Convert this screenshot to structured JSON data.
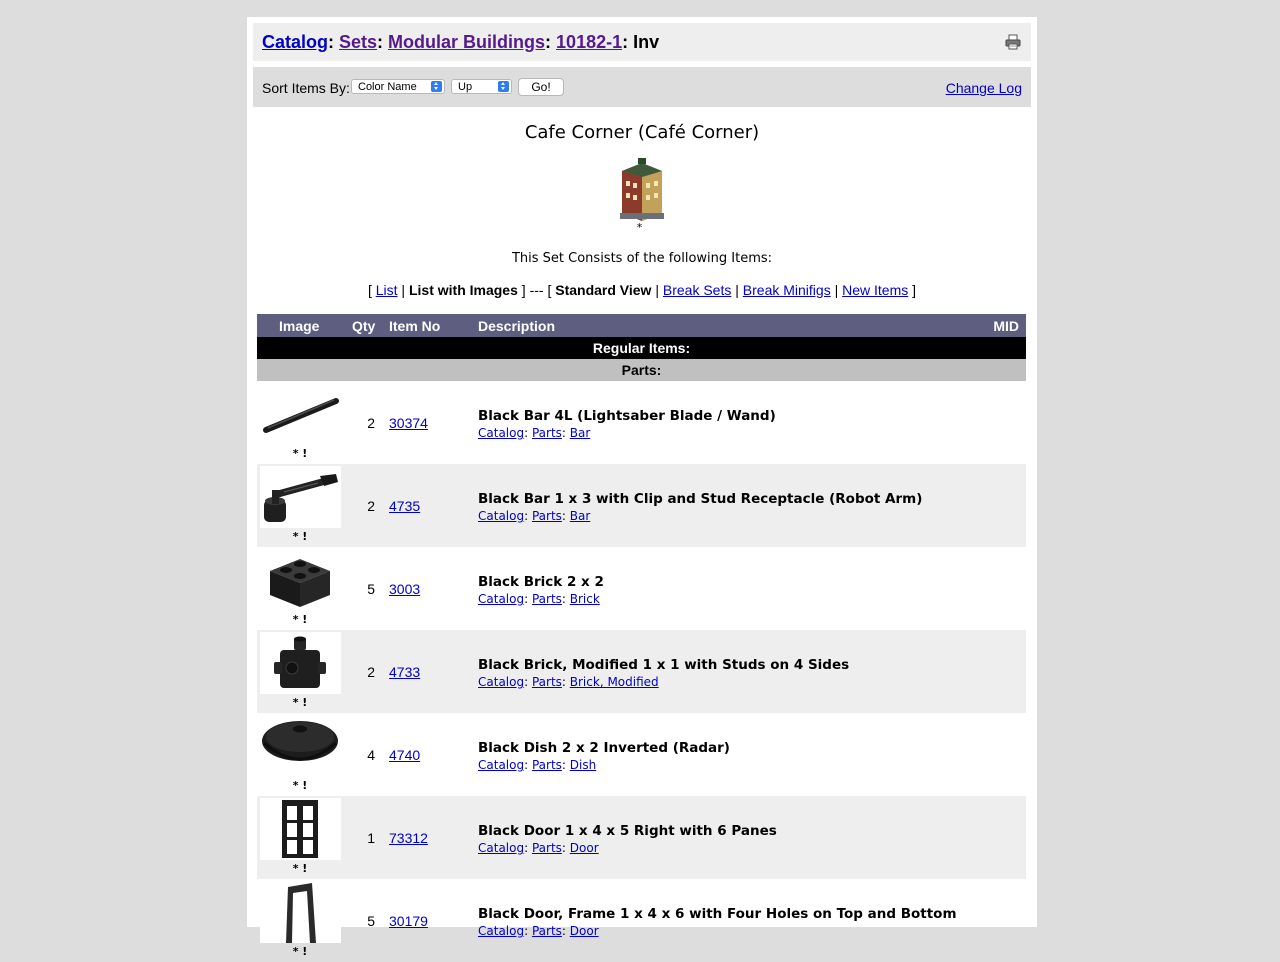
{
  "breadcrumb": {
    "items": [
      "Catalog",
      "Sets",
      "Modular Buildings",
      "10182-1"
    ],
    "current": "Inv"
  },
  "sort": {
    "label": "Sort Items By:",
    "field_selected": "Color Name",
    "direction_selected": "Up",
    "go_label": "Go!",
    "change_log": "Change Log"
  },
  "set": {
    "title": "Cafe Corner (Café Corner)",
    "image_marker": "*",
    "consists_text": "This Set Consists of the following Items:"
  },
  "view_links": {
    "list": "List",
    "list_with_images": "List with Images",
    "separator": "---",
    "standard_view": "Standard View",
    "break_sets": "Break Sets",
    "break_minifigs": "Break Minifigs",
    "new_items": "New Items"
  },
  "table": {
    "headers": {
      "image": "Image",
      "qty": "Qty",
      "item_no": "Item No",
      "description": "Description",
      "mid": "MID"
    },
    "section_regular": "Regular Items:",
    "section_parts": "Parts:",
    "rows": [
      {
        "marks": "* !",
        "qty": "2",
        "item_no": "30374",
        "name": "Black Bar 4L (Lightsaber Blade / Wand)",
        "cat1": "Catalog",
        "cat2": "Parts",
        "cat3": "Bar",
        "icon": "bar-4l-icon"
      },
      {
        "marks": "* !",
        "qty": "2",
        "item_no": "4735",
        "name": "Black Bar 1 x 3 with Clip and Stud Receptacle (Robot Arm)",
        "cat1": "Catalog",
        "cat2": "Parts",
        "cat3": "Bar",
        "icon": "robot-arm-icon"
      },
      {
        "marks": "* !",
        "qty": "5",
        "item_no": "3003",
        "name": "Black Brick 2 x 2",
        "cat1": "Catalog",
        "cat2": "Parts",
        "cat3": "Brick",
        "icon": "brick-2x2-icon"
      },
      {
        "marks": "* !",
        "qty": "2",
        "item_no": "4733",
        "name": "Black Brick, Modified 1 x 1 with Studs on 4 Sides",
        "cat1": "Catalog",
        "cat2": "Parts",
        "cat3": "Brick, Modified",
        "icon": "brick-studs-icon"
      },
      {
        "marks": "* !",
        "qty": "4",
        "item_no": "4740",
        "name": "Black Dish 2 x 2 Inverted (Radar)",
        "cat1": "Catalog",
        "cat2": "Parts",
        "cat3": "Dish",
        "icon": "dish-icon"
      },
      {
        "marks": "* !",
        "qty": "1",
        "item_no": "73312",
        "name": "Black Door 1 x 4 x 5 Right with 6 Panes",
        "cat1": "Catalog",
        "cat2": "Parts",
        "cat3": "Door",
        "icon": "door-icon"
      },
      {
        "marks": "* !",
        "qty": "5",
        "item_no": "30179",
        "name": "Black Door, Frame 1 x 4 x 6 with Four Holes on Top and Bottom",
        "cat1": "Catalog",
        "cat2": "Parts",
        "cat3": "Door",
        "icon": "door-frame-icon"
      }
    ]
  }
}
